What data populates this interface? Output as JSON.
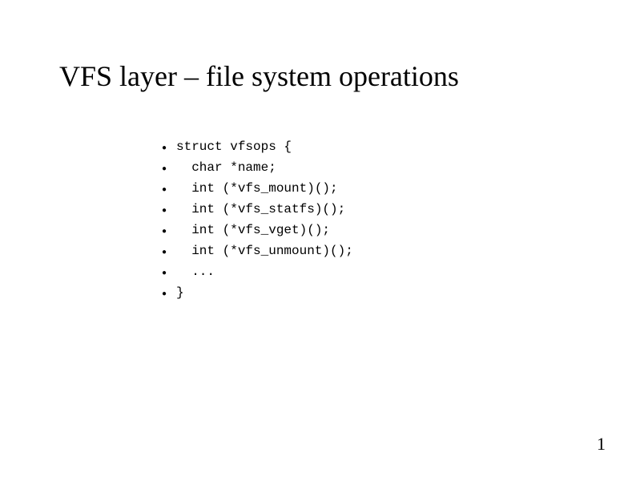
{
  "title": "VFS layer – file system operations",
  "code_lines": [
    "struct vfsops {",
    "  char *name;",
    "  int (*vfs_mount)();",
    "  int (*vfs_statfs)();",
    "  int (*vfs_vget)();",
    "  int (*vfs_unmount)();",
    "  ...",
    "}"
  ],
  "page_number": "1"
}
